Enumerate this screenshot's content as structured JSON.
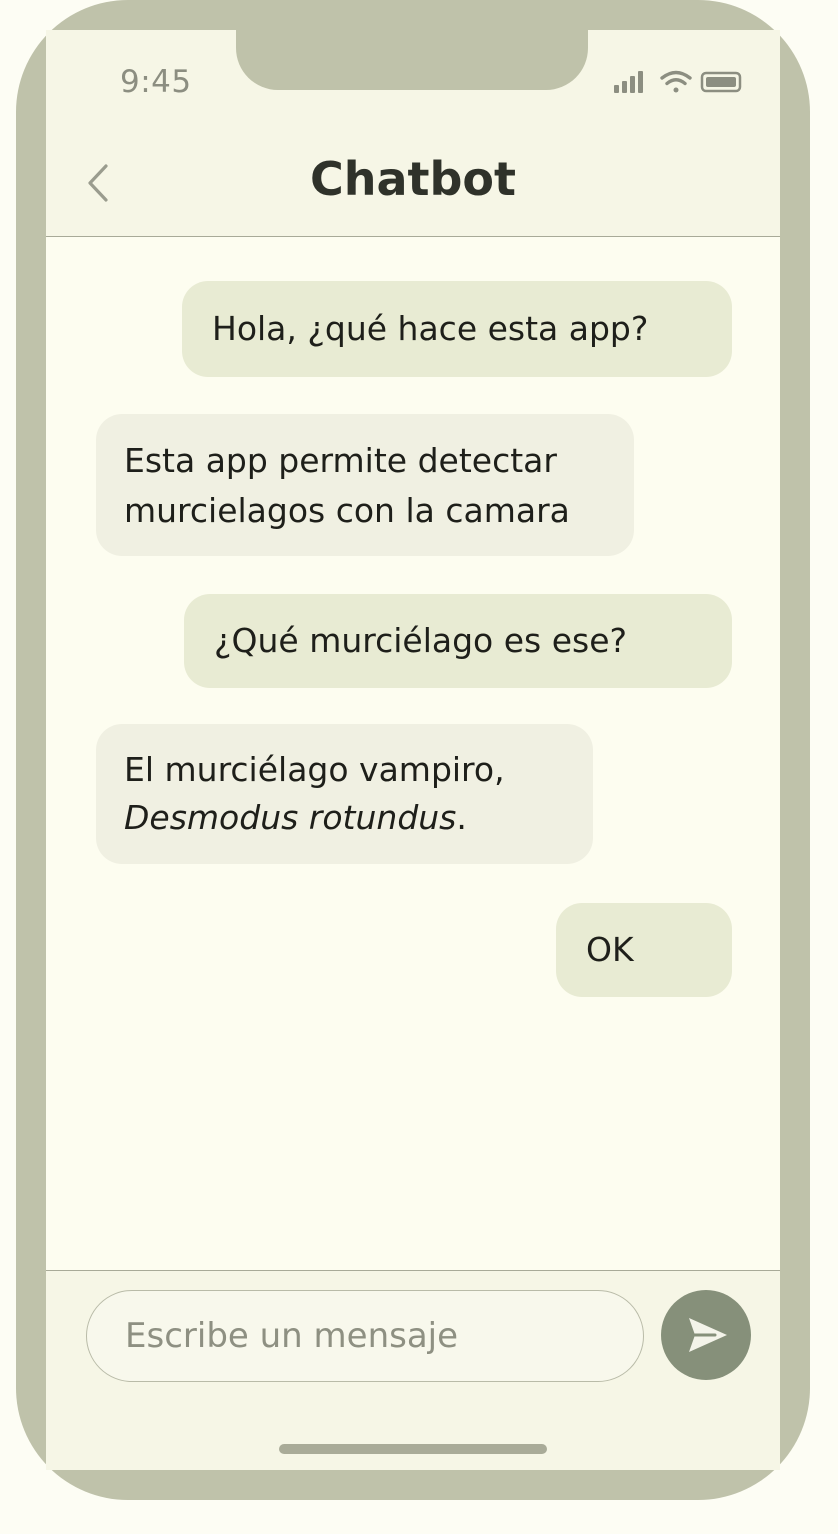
{
  "status_bar": {
    "time": "9:45",
    "icons": [
      "signal-icon",
      "wifi-icon",
      "battery-icon"
    ]
  },
  "header": {
    "title": "Chatbot",
    "back_icon": "chevron-left-icon"
  },
  "messages": [
    {
      "sender": "user",
      "lines": [
        "Hola, ¿qué hace esta app?"
      ]
    },
    {
      "sender": "bot",
      "lines": [
        "Esta app permite detectar",
        "murcielagos con la camara"
      ]
    },
    {
      "sender": "user",
      "lines": [
        "¿Qué murciélago es ese?"
      ]
    },
    {
      "sender": "bot",
      "lines": [
        "El murciélago vampiro,"
      ],
      "italic_line": "Desmodus rotundus",
      "italic_suffix": "."
    },
    {
      "sender": "user",
      "lines": [
        "OK"
      ]
    }
  ],
  "composer": {
    "placeholder": "Escribe un mensaje",
    "value": "",
    "send_icon": "send-icon"
  },
  "colors": {
    "frame": "#bfc2aa",
    "screen": "#fdfdf0",
    "user_bubble": "#e8ebd3",
    "bot_bubble": "#f0f0e2",
    "send_button": "#86907a"
  }
}
